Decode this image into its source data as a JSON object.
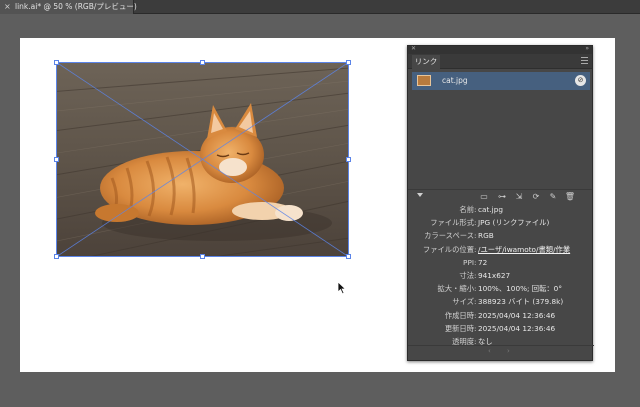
{
  "document": {
    "tab_title": "link.ai* @ 50 % (RGB/プレビュー)",
    "close_glyph": "×"
  },
  "links_panel": {
    "tab_label": "リンク",
    "items": [
      {
        "name": "cat.jpg",
        "selected": true
      }
    ],
    "toolbar_icons": [
      "cc-library-icon",
      "relink-icon",
      "go-to-link-icon",
      "update-link-icon",
      "edit-original-icon",
      "delete-icon"
    ],
    "info": [
      {
        "label": "名前",
        "value": "cat.jpg"
      },
      {
        "label": "ファイル形式",
        "value": "JPG (リンクファイル)"
      },
      {
        "label": "カラースペース",
        "value": "RGB"
      },
      {
        "label": "ファイルの位置",
        "value": "/ユーザ/iwamoto/書類/作業"
      },
      {
        "label": "PPI",
        "value": "72"
      },
      {
        "label": "寸法",
        "value": "941x627"
      },
      {
        "label": "拡大・縮小",
        "value": "100%、100%; 回転：0°"
      },
      {
        "label": "サイズ",
        "value": "388923 バイト (379.8k)"
      },
      {
        "label": "作成日時",
        "value": "2025/04/04 12:36:46"
      },
      {
        "label": "更新日時",
        "value": "2025/04/04 12:36:46"
      },
      {
        "label": "透明度",
        "value": "なし"
      }
    ]
  },
  "colors": {
    "selection": "#5b84e8",
    "row_selected": "#46607f",
    "panel_bg": "#474747"
  }
}
